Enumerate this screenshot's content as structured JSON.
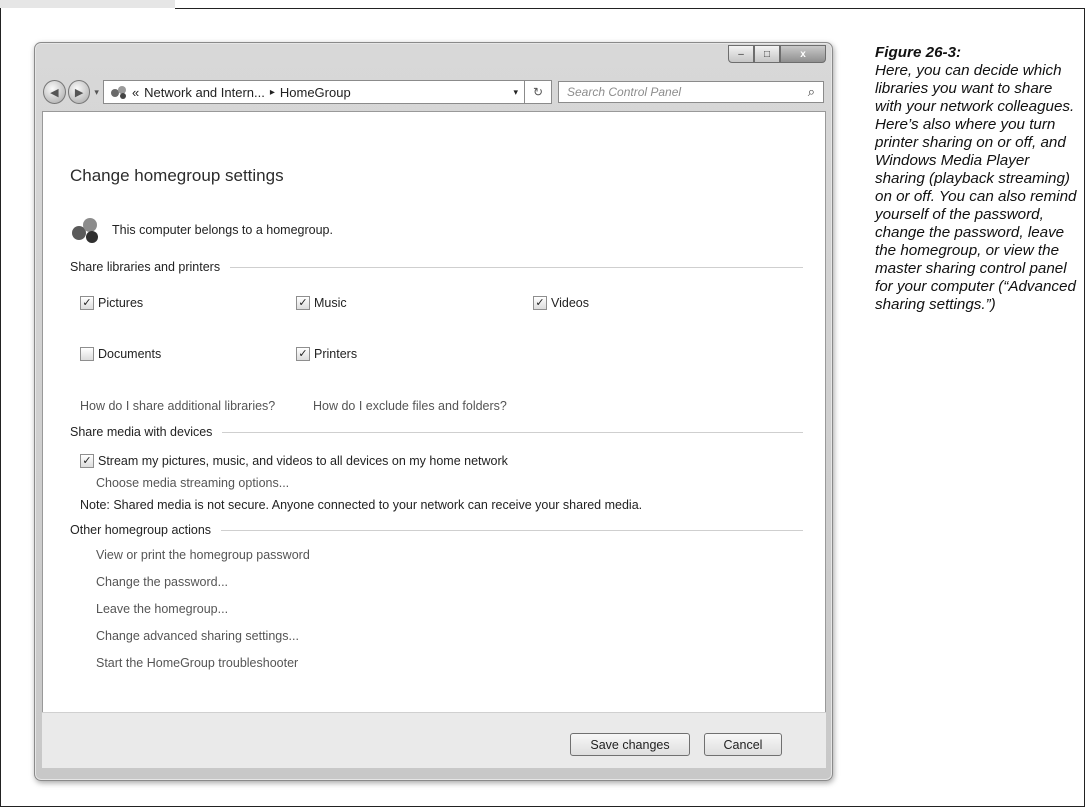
{
  "window": {
    "titlebar_buttons": {
      "minimize": "–",
      "maximize": "□",
      "close": "x"
    },
    "nav": {
      "back_icon": "back-arrow",
      "forward_icon": "forward-arrow"
    },
    "address": {
      "prefix": "«",
      "crumb1": "Network and Intern...",
      "crumb2": "HomeGroup",
      "separator": "▸",
      "dropdown": "▾",
      "refresh": "↻"
    },
    "search": {
      "placeholder": "Search Control Panel",
      "icon": "⌕"
    }
  },
  "main": {
    "title": "Change homegroup settings",
    "belongs_text": "This computer belongs to a homegroup.",
    "share_section": "Share libraries and printers",
    "libraries": [
      {
        "label": "Pictures",
        "checked": true
      },
      {
        "label": "Music",
        "checked": true
      },
      {
        "label": "Videos",
        "checked": true
      },
      {
        "label": "Documents",
        "checked": false
      },
      {
        "label": "Printers",
        "checked": true
      }
    ],
    "help_links": [
      "How do I share additional libraries?",
      "How do I exclude files and folders?"
    ],
    "media_section": "Share media with devices",
    "stream_label": "Stream my pictures, music, and videos to all devices on my home network",
    "stream_checked": true,
    "streaming_options": "Choose media streaming options...",
    "note": "Note: Shared media is not secure. Anyone connected to your network can receive your shared media.",
    "other_section": "Other homegroup actions",
    "actions": [
      "View or print the homegroup password",
      "Change the password...",
      "Leave the homegroup...",
      "Change advanced sharing settings...",
      "Start the HomeGroup troubleshooter"
    ]
  },
  "footer": {
    "save": "Save changes",
    "cancel": "Cancel"
  },
  "caption": {
    "figure": "Figure 26-3:",
    "text": "Here, you can decide which libraries you want to share with your network colleagues. Here’s also where you turn printer sharing on or off, and Windows Media Player sharing (playback streaming) on or off. You can also remind yourself of the password, change the password, leave the homegroup, or view the master sharing control panel for your computer (“Advanced sharing settings.”)"
  }
}
